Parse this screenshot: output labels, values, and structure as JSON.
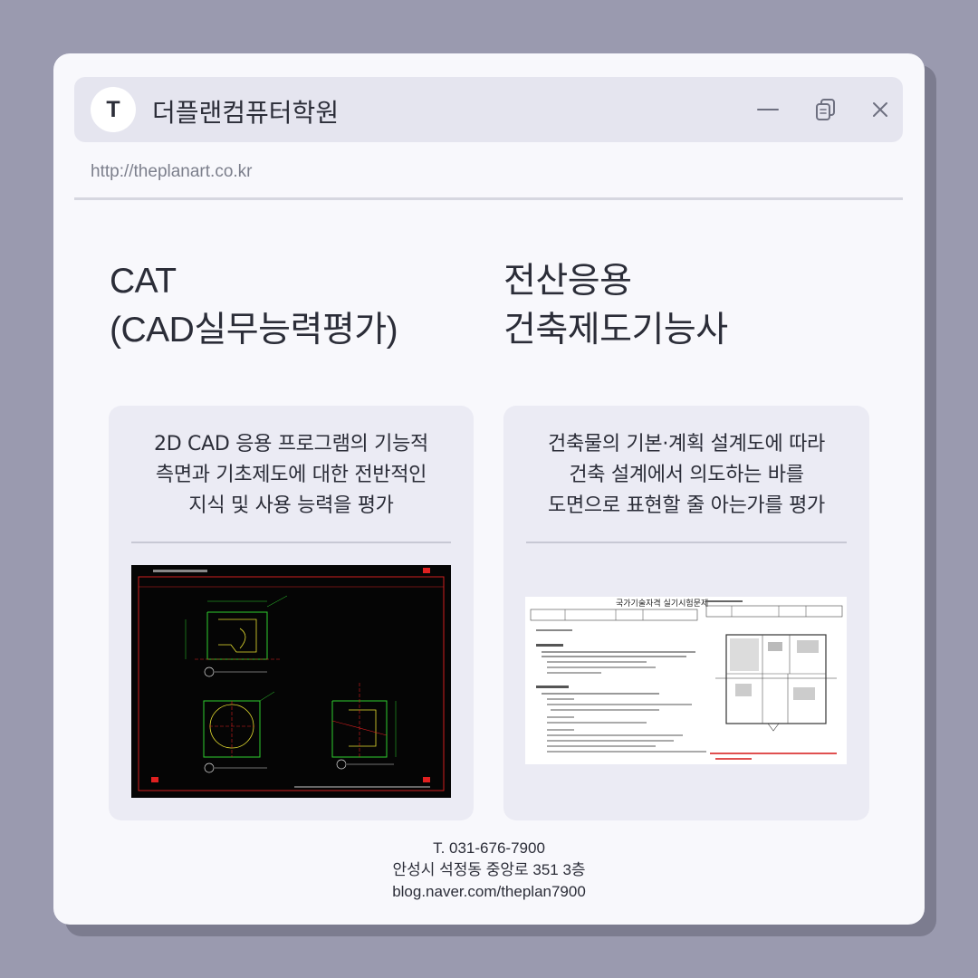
{
  "window": {
    "logo_letter": "T",
    "title": "더플랜컴퓨터학원",
    "url": "http://theplanart.co.kr",
    "controls": [
      "minimize-icon",
      "copy-icon",
      "close-icon"
    ]
  },
  "left": {
    "heading": [
      "CAT",
      "(CAD실무능력평가)"
    ],
    "description": [
      "2D CAD 응용 프로그램의 기능적",
      "측면과 기초제도에 대한 전반적인",
      "지식 및 사용 능력을 평가"
    ],
    "image": "cad-drawing-preview"
  },
  "right": {
    "heading": [
      "전산응용",
      "건축제도기능사"
    ],
    "description": [
      "건축물의 기본·계획 설계도에 따라",
      "건축 설계에서 의도하는 바를",
      "도면으로 표현할 줄 아는가를 평가"
    ],
    "image": "exam-document-preview",
    "doc_title": "국가기술자격 실기시험문제"
  },
  "footer": {
    "phone": "T. 031-676-7900",
    "address": "안성시 석정동 중앙로 351 3층",
    "blog": "blog.naver.com/theplan7900"
  },
  "colors": {
    "background": "#9a9aaf",
    "window": "#f8f8fc",
    "titlebar": "#e5e5ef",
    "card": "#ebebf4",
    "text": "#2b2d38",
    "cad_red": "#e02020",
    "cad_green": "#2fd02f",
    "cad_yellow": "#e8e030"
  }
}
